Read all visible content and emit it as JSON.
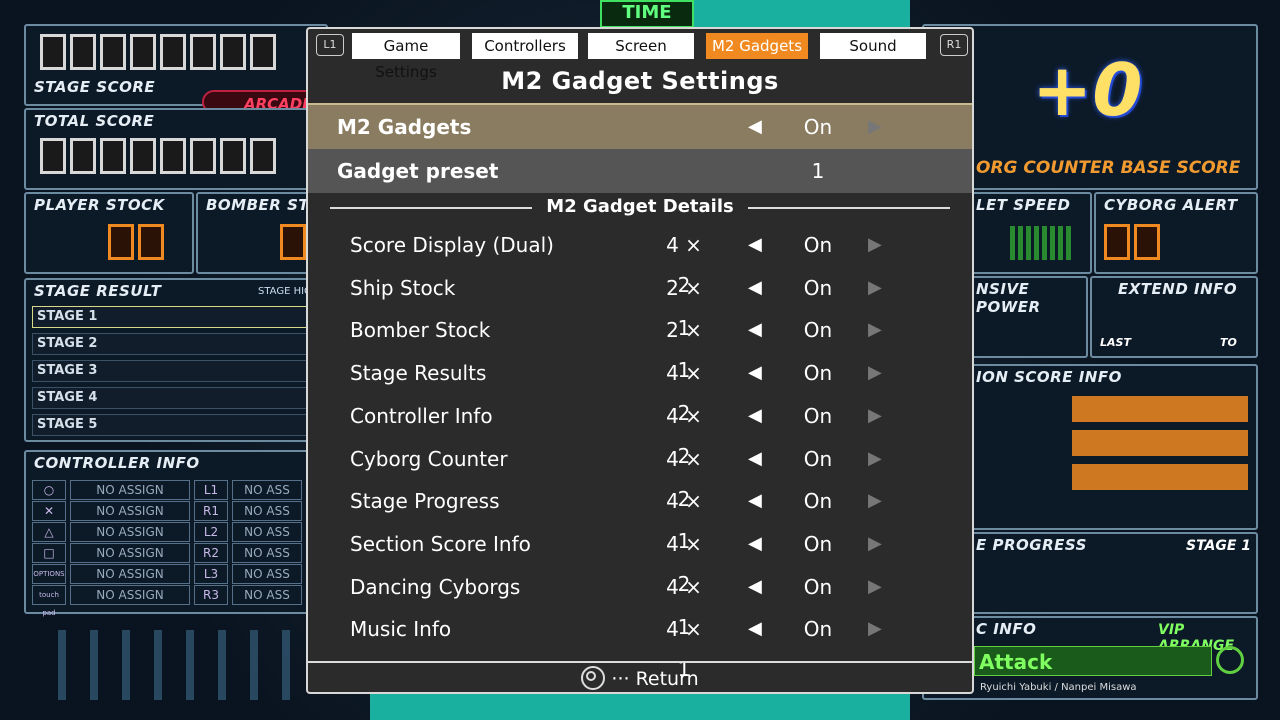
{
  "hud": {
    "stage_score_label": "STAGE SCORE",
    "total_score_label": "TOTAL SCORE",
    "arcade_label": "ARCADE",
    "time_label": "TIME",
    "player_stock_label": "PLAYER STOCK",
    "bomber_stock_label": "BOMBER ST",
    "stage_result_label": "STAGE RESULT",
    "stage_high_label": "STAGE HIGH",
    "stages": [
      "STAGE 1",
      "STAGE 2",
      "STAGE 3",
      "STAGE 4",
      "STAGE 5"
    ],
    "controller_info_label": "CONTROLLER INFO",
    "controller_rows": [
      {
        "icon": "○",
        "assign": "NO ASSIGN",
        "sbtn": "L1",
        "sassign": "NO ASS"
      },
      {
        "icon": "✕",
        "assign": "NO ASSIGN",
        "sbtn": "R1",
        "sassign": "NO ASS"
      },
      {
        "icon": "△",
        "assign": "NO ASSIGN",
        "sbtn": "L2",
        "sassign": "NO ASS"
      },
      {
        "icon": "□",
        "assign": "NO ASSIGN",
        "sbtn": "R2",
        "sassign": "NO ASS"
      },
      {
        "icon": "OPTIONS",
        "assign": "NO ASSIGN",
        "sbtn": "L3",
        "sassign": "NO ASS"
      },
      {
        "icon": "touch pad",
        "assign": "NO ASSIGN",
        "sbtn": "R3",
        "sassign": "NO ASS"
      }
    ],
    "plus_value": "+0",
    "cyborg_counter_label": "ORG COUNTER BASE SCORE",
    "bullet_speed_label": "LET SPEED",
    "cyborg_alert_label": "CYBORG ALERT",
    "offensive_power_label": "NSIVE POWER",
    "extend_info_label": "EXTEND INFO",
    "last_label": "LAST",
    "to_label": "TO",
    "section_score_label": "ION SCORE INFO",
    "stage_progress_label": "E PROGRESS",
    "stage_progress_value": "STAGE 1",
    "music_info_label": "C INFO",
    "vip_arrange_label": "VIP ARRANGE",
    "track_title": "Attack",
    "composers": "Ryuichi Yabuki / Nanpei Misawa"
  },
  "modal": {
    "l1": "L1",
    "r1": "R1",
    "tabs": [
      "Game Settings",
      "Controllers",
      "Screen",
      "M2 Gadgets",
      "Sound"
    ],
    "active_tab": "M2 Gadgets",
    "title": "M2 Gadget Settings",
    "main_rows": [
      {
        "label": "M2 Gadgets",
        "value": "On"
      },
      {
        "label": "Gadget preset",
        "value": "1"
      }
    ],
    "details_title": "M2 Gadget Details",
    "details": [
      {
        "label": "Score Display (Dual)",
        "size": "4 × 2",
        "value": "On"
      },
      {
        "label": "Ship Stock",
        "size": "2 × 1",
        "value": "On"
      },
      {
        "label": "Bomber Stock",
        "size": "2 × 1",
        "value": "On"
      },
      {
        "label": "Stage Results",
        "size": "4 × 2",
        "value": "On"
      },
      {
        "label": "Controller Info",
        "size": "4 × 2",
        "value": "On"
      },
      {
        "label": "Cyborg Counter",
        "size": "4 × 2",
        "value": "On"
      },
      {
        "label": "Stage Progress",
        "size": "4 × 1",
        "value": "On"
      },
      {
        "label": "Section Score Info",
        "size": "4 × 2",
        "value": "On"
      },
      {
        "label": "Dancing Cyborgs",
        "size": "4 × 1",
        "value": "On"
      },
      {
        "label": "Music Info",
        "size": "4 × 1",
        "value": "On"
      }
    ],
    "footer": "··· Return"
  }
}
